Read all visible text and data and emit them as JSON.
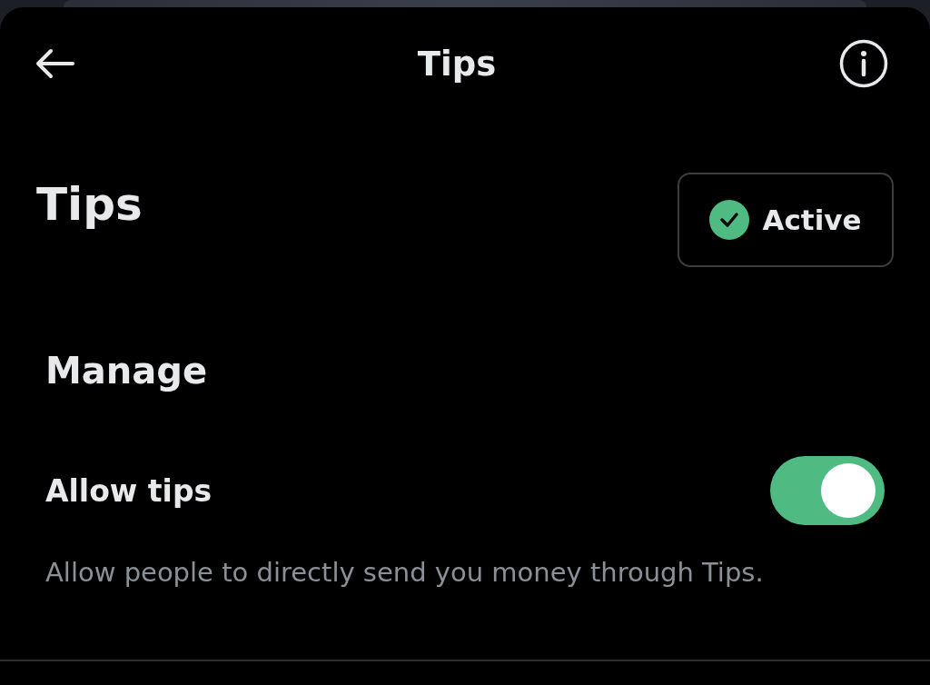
{
  "header": {
    "title": "Tips"
  },
  "heading": "Tips",
  "status_badge": {
    "label": "Active",
    "active": true
  },
  "section": {
    "title": "Manage"
  },
  "setting": {
    "label": "Allow tips",
    "on": true,
    "description": "Allow people to directly send you money through Tips."
  }
}
